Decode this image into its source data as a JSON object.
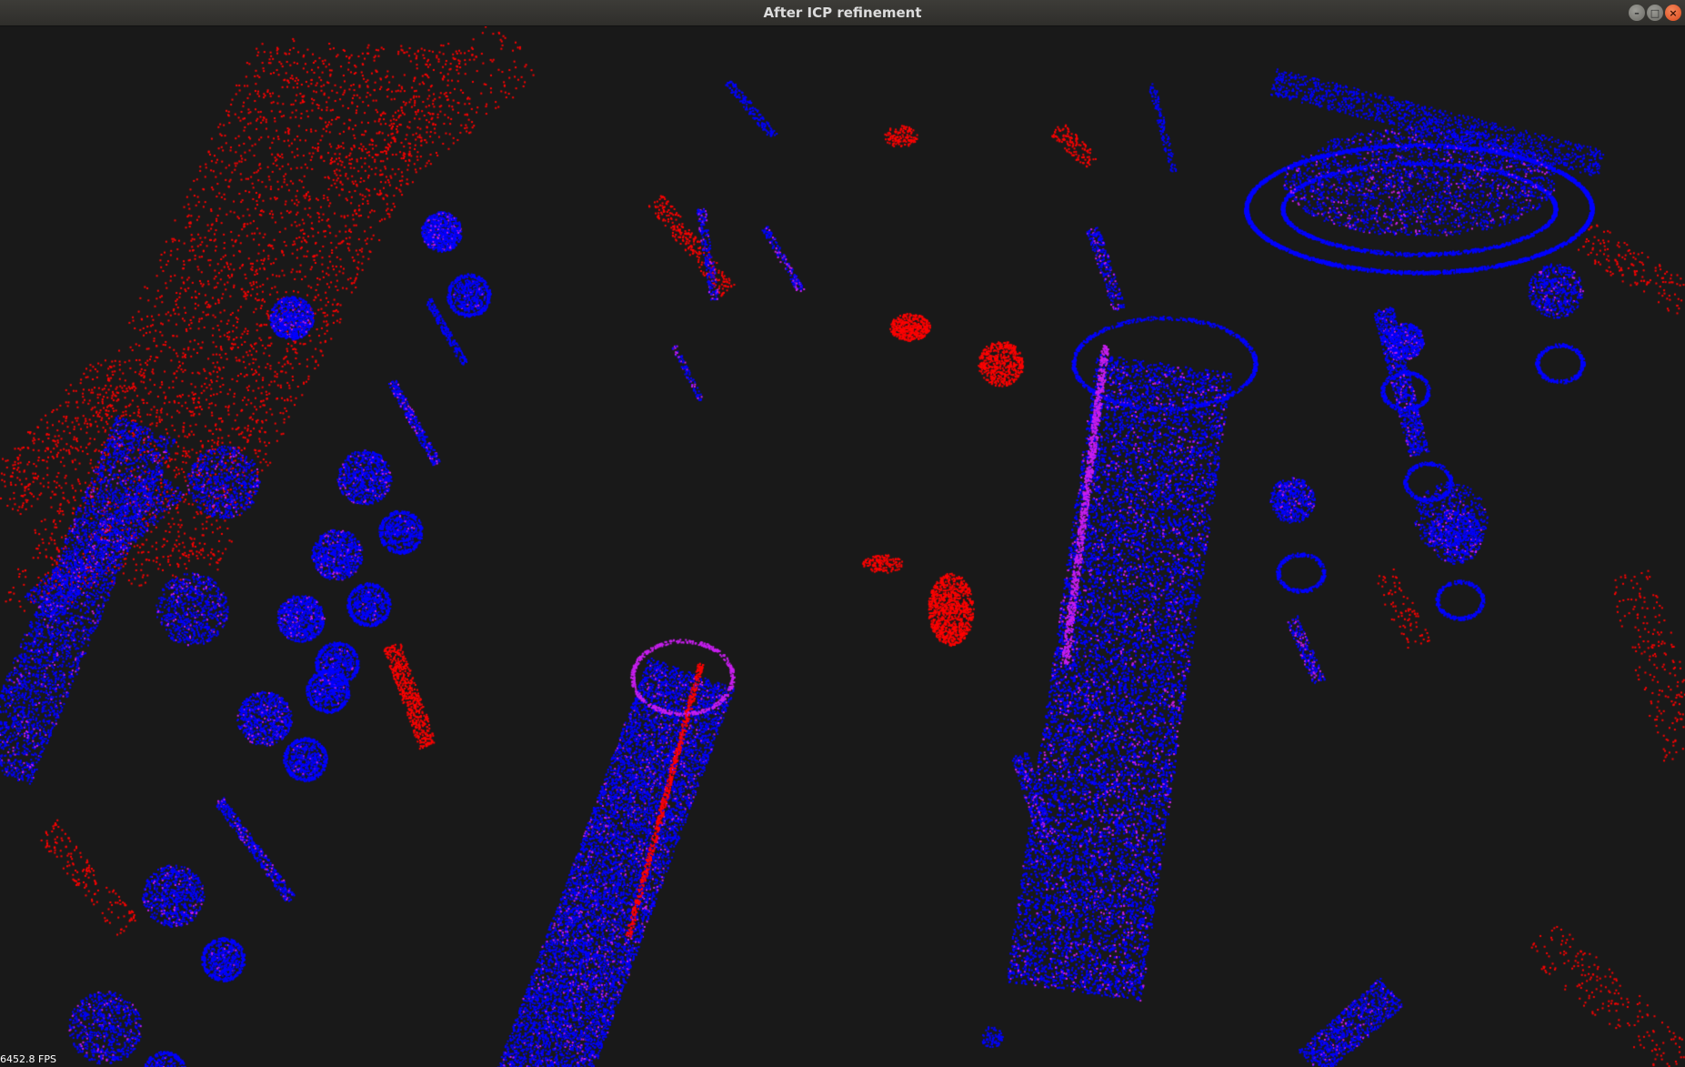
{
  "window": {
    "title": "After ICP refinement",
    "controls": [
      {
        "name": "minimize",
        "icon": "minimize-icon",
        "glyph": "–"
      },
      {
        "name": "maximize",
        "icon": "maximize-icon",
        "glyph": "□"
      },
      {
        "name": "close",
        "icon": "close-icon",
        "glyph": "×"
      }
    ]
  },
  "viewer": {
    "fps_label": "6452.8 FPS",
    "background_color": "#191919",
    "source_cloud_color": "#ff0000",
    "target_cloud_color": "#0000ff",
    "overlap_color": "#c81ef0"
  }
}
